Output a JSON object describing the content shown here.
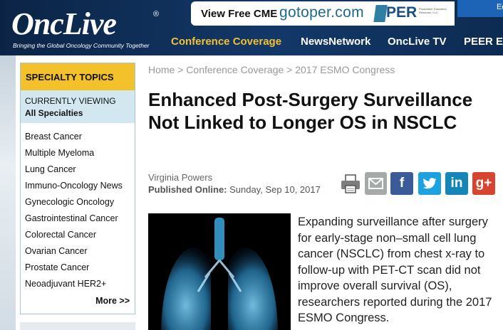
{
  "header": {
    "logo_text": "OncLive",
    "logo_reg": "®",
    "tagline": "Bringing the Global Oncology Community Together",
    "cme_label": "View Free CME",
    "cme_brand": "gotoper.com",
    "peer_label": "PER",
    "peer_small": "Physicians' Education Resource, LLC",
    "edu_tab": "Ed"
  },
  "nav": {
    "items": [
      {
        "label": "Conference Coverage"
      },
      {
        "label": "NewsNetwork"
      },
      {
        "label": "OncLive TV"
      },
      {
        "label": "PEER E"
      }
    ]
  },
  "sidebar": {
    "heading": "SPECIALTY TOPICS",
    "current_label": "CURRENTLY VIEWING",
    "current_value": "All Specialties",
    "items": [
      {
        "label": "Breast Cancer"
      },
      {
        "label": "Multiple Myeloma"
      },
      {
        "label": "Lung Cancer"
      },
      {
        "label": "Immuno-Oncology News"
      },
      {
        "label": "Gynecologic Oncology"
      },
      {
        "label": "Gastrointestinal Cancer"
      },
      {
        "label": "Colorectal Cancer"
      },
      {
        "label": "Ovarian Cancer"
      },
      {
        "label": "Prostate Cancer"
      },
      {
        "label": "Neoadjuvant HER2+"
      }
    ],
    "more_label": "More >>"
  },
  "article": {
    "breadcrumb": "Home > Conference Coverage > 2017 ESMO Congress",
    "headline": "Enhanced Post-Surgery Surveillance Not Linked to Longer OS in NSCLC",
    "author": "Virginia Powers",
    "published_label": "Published Online:",
    "published_date": "Sunday, Sep 10, 2017",
    "body": "Expanding surveillance after surgery for early-stage non–small cell lung cancer (NSCLC) from chest x-ray to follow-up with PET-CT scan did not improve overall survival (OS), researchers reported during the 2017 ESMO Congress."
  },
  "share": {
    "facebook": "f",
    "linkedin": "in",
    "googleplus": "g+"
  },
  "colors": {
    "header_bg": "#0d2b52",
    "nav_accent": "#f2c232",
    "sidebar_head": "#f3c12a",
    "sidebar_current": "#d3e7f0"
  },
  "icons": [
    "print-icon",
    "email-icon",
    "facebook-icon",
    "twitter-icon",
    "linkedin-icon",
    "googleplus-icon"
  ]
}
